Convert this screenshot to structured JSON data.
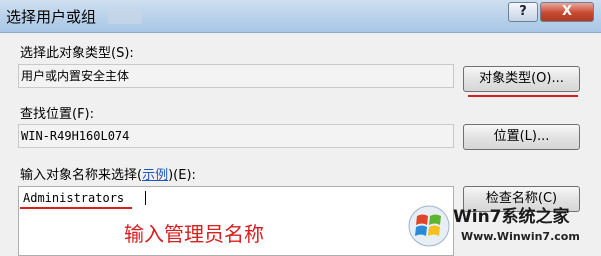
{
  "window": {
    "title": "选择用户或组",
    "help_label": "?",
    "close_label": "X"
  },
  "object_type": {
    "label": "选择此对象类型(S):",
    "value": "用户或内置安全主体",
    "button_label": "对象类型(O)..."
  },
  "location": {
    "label": "查找位置(F):",
    "value": "WIN-R49H160L074",
    "button_label": "位置(L)..."
  },
  "names": {
    "label_prefix": "输入对象名称来选择(",
    "label_link": "示例",
    "label_suffix": ")(E):",
    "value": "Administrators",
    "check_button_label": "检查名称(C)"
  },
  "annotation": {
    "text": "输入管理员名称",
    "color": "#d82020"
  },
  "watermark": {
    "brand": "Win7系统之家",
    "url": "Www.Winwin7.com"
  },
  "colors": {
    "highlight_underline": "#d42020",
    "link": "#1a57c4"
  }
}
